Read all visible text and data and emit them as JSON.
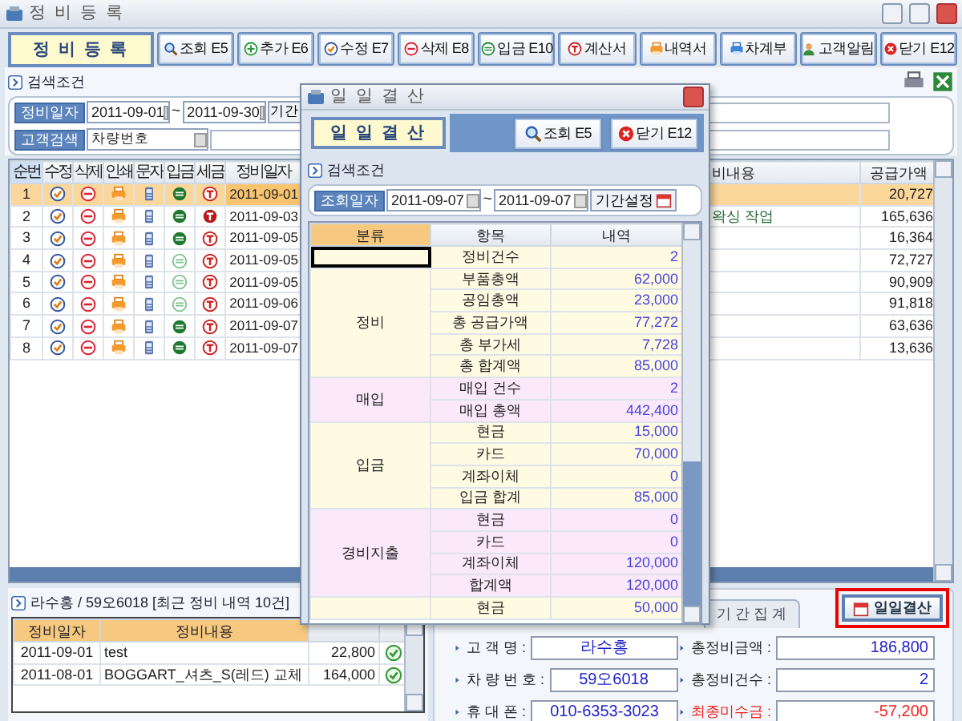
{
  "window": {
    "title": "정 비 등 록"
  },
  "toolbar": {
    "title": "정 비 등 록",
    "buttons": [
      {
        "label": "조회 E5",
        "kind": "search"
      },
      {
        "label": "추가 E6",
        "kind": "plus"
      },
      {
        "label": "수정 E7",
        "kind": "check"
      },
      {
        "label": "삭제 E8",
        "kind": "minus"
      },
      {
        "label": "입금 E10",
        "kind": "coin"
      },
      {
        "label": "계산서",
        "kind": "tax"
      },
      {
        "label": "내역서",
        "kind": "printer"
      },
      {
        "label": "차계부",
        "kind": "bluebook"
      },
      {
        "label": "고객알림",
        "kind": "person"
      },
      {
        "label": "닫기 E12",
        "kind": "close"
      }
    ]
  },
  "search": {
    "title": "검색조건",
    "date_label": "정비일자",
    "date_from": "2011-09-01",
    "separator": "~",
    "date_to": "2011-09-30",
    "period_button": "기간",
    "customer_label": "고객검색",
    "customer_type": "차량번호"
  },
  "table": {
    "columns": [
      "순번",
      "수정",
      "삭제",
      "인쇄",
      "문자",
      "입금",
      "세금",
      "정비일자",
      "비내용",
      "공급가액"
    ],
    "rows": [
      {
        "no": "1",
        "date": "2011-09-01",
        "amount": "20,727",
        "paid": true,
        "tax_issued": false,
        "selected": true
      },
      {
        "no": "2",
        "date": "2011-09-03",
        "content": "왁싱 작업",
        "amount": "165,636",
        "paid": true,
        "tax_issued": true,
        "selected": false
      },
      {
        "no": "3",
        "date": "2011-09-05",
        "amount": "16,364",
        "paid": true,
        "tax_issued": false,
        "selected": false
      },
      {
        "no": "4",
        "date": "2011-09-05",
        "amount": "72,727",
        "paid": false,
        "tax_issued": false,
        "selected": false
      },
      {
        "no": "5",
        "date": "2011-09-05",
        "amount": "90,909",
        "paid": false,
        "tax_issued": false,
        "selected": false
      },
      {
        "no": "6",
        "date": "2011-09-06",
        "amount": "91,818",
        "paid": false,
        "tax_issued": false,
        "selected": false
      },
      {
        "no": "7",
        "date": "2011-09-07",
        "amount": "63,636",
        "paid": true,
        "tax_issued": false,
        "selected": false
      },
      {
        "no": "8",
        "date": "2011-09-07",
        "amount": "13,636",
        "paid": true,
        "tax_issued": false,
        "selected": false
      }
    ]
  },
  "recent": {
    "title": "라수홍 / 59오6018 [최근 정비 내역 10건]",
    "columns": [
      "정비일자",
      "정비내용"
    ],
    "rows": [
      {
        "date": "2011-09-01",
        "content": "test",
        "amount": "22,800",
        "done": true
      },
      {
        "date": "2011-08-01",
        "content": "BOGGART_셔츠_S(레드) 교체",
        "amount": "164,000",
        "done": true
      }
    ]
  },
  "tabs": [
    {
      "label": "기 간 집 계",
      "selected": false
    }
  ],
  "daily_button": {
    "label": "일일결산",
    "highlighted": true
  },
  "summary": [
    {
      "label": "고 객 명 :",
      "value": "라수홍",
      "kind": "info"
    },
    {
      "label": "총정비금액 :",
      "value": "186,800",
      "kind": "amount"
    },
    {
      "label": "차 량 번 호 :",
      "value": "59오6018",
      "kind": "info"
    },
    {
      "label": "총정비건수 :",
      "value": "2",
      "kind": "amount"
    },
    {
      "label": "휴 대 폰 :",
      "value": "010-6353-3023",
      "kind": "info"
    },
    {
      "label": "최종미수금 :",
      "value": "-57,200",
      "kind": "alert"
    }
  ],
  "dialog": {
    "title": "일 일 결 산",
    "heading": "일 일 결 산",
    "buttons": [
      {
        "label": "조회 E5",
        "kind": "search"
      },
      {
        "label": "닫기 E12",
        "kind": "close"
      }
    ],
    "search_title": "검색조건",
    "date_label": "조회일자",
    "date_from": "2011-09-07",
    "separator": "~",
    "date_to": "2011-09-07",
    "period_button": "기간설정",
    "columns": [
      "분류",
      "항목",
      "내역"
    ],
    "groups": [
      {
        "color": "#fffbe3",
        "selected": true,
        "rows": [
          {
            "item": "정비건수",
            "value": "2"
          }
        ]
      },
      {
        "category": "정비",
        "color": "#fffbe3",
        "selected": false,
        "rows": [
          {
            "item": "부품총액",
            "value": "62,000"
          },
          {
            "item": "공임총액",
            "value": "23,000"
          },
          {
            "item": "총 공급가액",
            "value": "77,272"
          },
          {
            "item": "총 부가세",
            "value": "7,728"
          },
          {
            "item": "총 합계액",
            "value": "85,000"
          }
        ]
      },
      {
        "category": "매입",
        "color": "#fbe8fb",
        "selected": false,
        "rows": [
          {
            "item": "매입 건수",
            "value": "2"
          },
          {
            "item": "매입 총액",
            "value": "442,400"
          }
        ]
      },
      {
        "category": "입금",
        "color": "#fffbe3",
        "selected": false,
        "rows": [
          {
            "item": "현금",
            "value": "15,000"
          },
          {
            "item": "카드",
            "value": "70,000"
          },
          {
            "item": "계좌이체",
            "value": "0"
          },
          {
            "item": "입금 합계",
            "value": "85,000"
          }
        ]
      },
      {
        "category": "경비지출",
        "color": "#fbe8fb",
        "selected": false,
        "rows": [
          {
            "item": "현금",
            "value": "0"
          },
          {
            "item": "카드",
            "value": "0"
          },
          {
            "item": "계좌이체",
            "value": "120,000"
          },
          {
            "item": "합계액",
            "value": "120,000"
          }
        ]
      },
      {
        "color": "#fffbe3",
        "selected": false,
        "rows": [
          {
            "item": "현금",
            "value": "50,000"
          }
        ]
      }
    ]
  }
}
